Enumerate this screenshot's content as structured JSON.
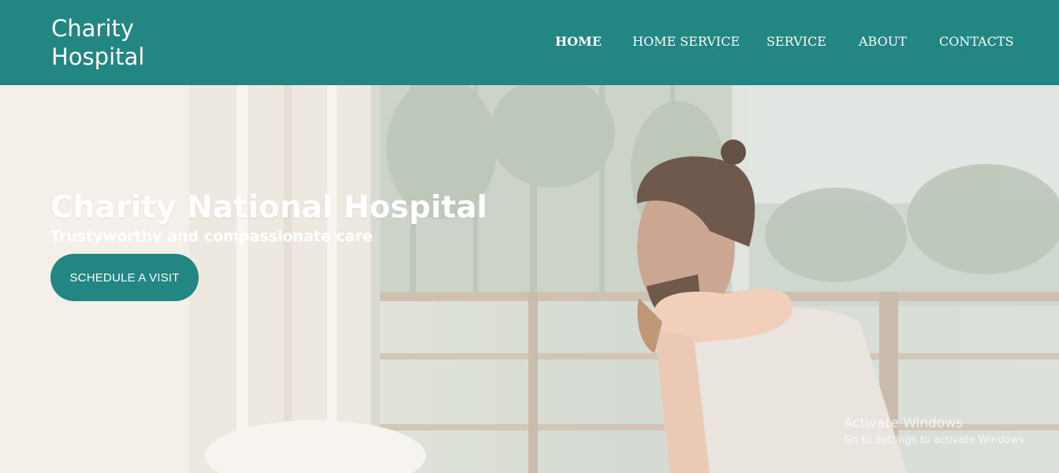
{
  "brand": {
    "line1": "Charity",
    "line2": "Hospital"
  },
  "nav": {
    "items": [
      {
        "label": "HOME",
        "active": true
      },
      {
        "label": "HOME SERVICE",
        "active": false
      },
      {
        "label": "SERVICE",
        "active": false
      },
      {
        "label": "ABOUT",
        "active": false
      },
      {
        "label": "CONTACTS",
        "active": false
      }
    ]
  },
  "hero": {
    "title": "Charity National Hospital",
    "subtitle": "Trustyworthy and compassionate care",
    "cta_label": "SCHEDULE A VISIT"
  },
  "watermark": {
    "title": "Activate Windows",
    "subtitle": "Go to Settings to activate Windows."
  },
  "colors": {
    "brand_teal": "#228783",
    "text_light": "#ffffff"
  }
}
